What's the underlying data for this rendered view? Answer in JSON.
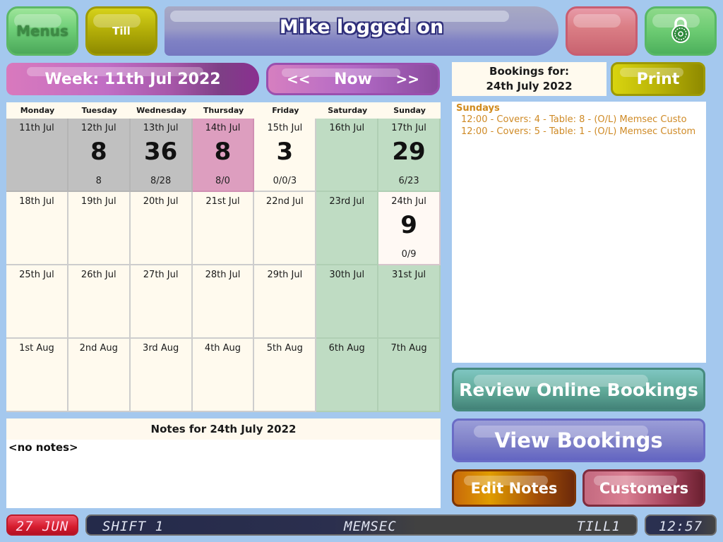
{
  "header": {
    "menus_label": "Menus",
    "till_label": "Till",
    "title": "Mike logged on",
    "lock_icon": "padlock-combination-icon"
  },
  "week_nav": {
    "week_label": "Week: 11th Jul 2022",
    "prev_label": "<<",
    "now_label": "Now",
    "next_label": ">>"
  },
  "bookings_panel": {
    "heading_line1": "Bookings for:",
    "heading_line2": "24th July 2022",
    "print_label": "Print",
    "groups": [
      {
        "name": "Sundays",
        "entries": [
          "12:00 - Covers: 4 - Table: 8 - (O/L) Memsec Custo",
          "12:00 - Covers: 5 - Table: 1 - (O/L) Memsec Custom"
        ]
      }
    ]
  },
  "calendar": {
    "weekdays": [
      "Monday",
      "Tuesday",
      "Wednesday",
      "Thursday",
      "Friday",
      "Saturday",
      "Sunday"
    ],
    "weeks": [
      [
        {
          "date": "11th Jul",
          "count": "",
          "sub": "",
          "state": "past"
        },
        {
          "date": "12th Jul",
          "count": "8",
          "sub": "8",
          "state": "past"
        },
        {
          "date": "13th Jul",
          "count": "36",
          "sub": "8/28",
          "state": "past"
        },
        {
          "date": "14th Jul",
          "count": "8",
          "sub": "8/0",
          "state": "today"
        },
        {
          "date": "15th Jul",
          "count": "3",
          "sub": "0/0/3",
          "state": "normal"
        },
        {
          "date": "16th Jul",
          "count": "",
          "sub": "",
          "state": "weekend"
        },
        {
          "date": "17th Jul",
          "count": "29",
          "sub": "6/23",
          "state": "weekend"
        }
      ],
      [
        {
          "date": "18th Jul",
          "count": "",
          "sub": "",
          "state": "normal"
        },
        {
          "date": "19th Jul",
          "count": "",
          "sub": "",
          "state": "normal"
        },
        {
          "date": "20th Jul",
          "count": "",
          "sub": "",
          "state": "normal"
        },
        {
          "date": "21st Jul",
          "count": "",
          "sub": "",
          "state": "normal"
        },
        {
          "date": "22nd Jul",
          "count": "",
          "sub": "",
          "state": "normal"
        },
        {
          "date": "23rd Jul",
          "count": "",
          "sub": "",
          "state": "weekend"
        },
        {
          "date": "24th Jul",
          "count": "9",
          "sub": "0/9",
          "state": "selected"
        }
      ],
      [
        {
          "date": "25th Jul",
          "count": "",
          "sub": "",
          "state": "normal"
        },
        {
          "date": "26th Jul",
          "count": "",
          "sub": "",
          "state": "normal"
        },
        {
          "date": "27th Jul",
          "count": "",
          "sub": "",
          "state": "normal"
        },
        {
          "date": "28th Jul",
          "count": "",
          "sub": "",
          "state": "normal"
        },
        {
          "date": "29th Jul",
          "count": "",
          "sub": "",
          "state": "normal"
        },
        {
          "date": "30th Jul",
          "count": "",
          "sub": "",
          "state": "weekend"
        },
        {
          "date": "31st Jul",
          "count": "",
          "sub": "",
          "state": "weekend"
        }
      ],
      [
        {
          "date": "1st Aug",
          "count": "",
          "sub": "",
          "state": "normal"
        },
        {
          "date": "2nd Aug",
          "count": "",
          "sub": "",
          "state": "normal"
        },
        {
          "date": "3rd Aug",
          "count": "",
          "sub": "",
          "state": "normal"
        },
        {
          "date": "4th Aug",
          "count": "",
          "sub": "",
          "state": "normal"
        },
        {
          "date": "5th Aug",
          "count": "",
          "sub": "",
          "state": "normal"
        },
        {
          "date": "6th Aug",
          "count": "",
          "sub": "",
          "state": "weekend"
        },
        {
          "date": "7th Aug",
          "count": "",
          "sub": "",
          "state": "weekend"
        }
      ]
    ]
  },
  "notes": {
    "heading": "Notes for 24th July 2022",
    "body": "<no notes>"
  },
  "actions": {
    "review_online": "Review Online Bookings",
    "view_bookings": "View Bookings",
    "edit_notes": "Edit Notes",
    "customers": "Customers"
  },
  "status_bar": {
    "date": "27 JUN",
    "shift": "SHIFT 1",
    "site": "MEMSEC",
    "till": "TILL1",
    "time": "12:57"
  }
}
